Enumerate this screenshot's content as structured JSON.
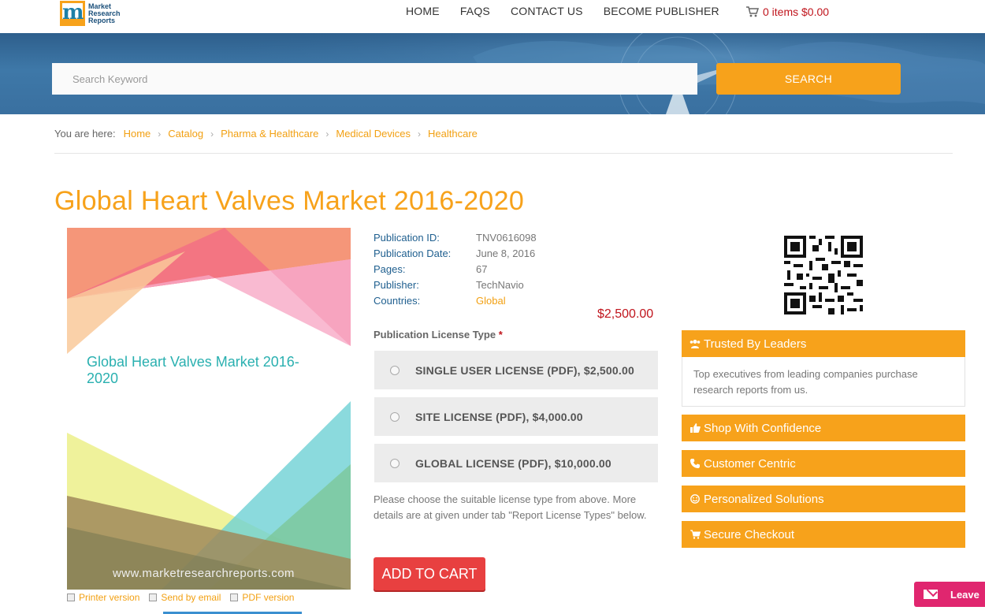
{
  "header": {
    "logo_text": [
      "Market",
      "Research",
      "Reports"
    ],
    "nav": [
      "HOME",
      "FAQS",
      "CONTACT US",
      "BECOME PUBLISHER"
    ],
    "cart": "0 items $0.00"
  },
  "search": {
    "placeholder": "Search Keyword",
    "button": "SEARCH"
  },
  "breadcrumb": {
    "lead": "You are here:",
    "items": [
      "Home",
      "Catalog",
      "Pharma & Healthcare",
      "Medical Devices",
      "Healthcare"
    ]
  },
  "title": "Global Heart Valves Market 2016-2020",
  "cover": {
    "title": "Global Heart Valves Market 2016-2020",
    "url": "www.marketresearchreports.com",
    "links": [
      "Printer version",
      "Send by email",
      "PDF version"
    ]
  },
  "meta": {
    "rows": [
      {
        "label": "Publication ID:",
        "value": "TNV0616098"
      },
      {
        "label": "Publication Date:",
        "value": "June 8, 2016"
      },
      {
        "label": "Pages:",
        "value": "67"
      },
      {
        "label": "Publisher:",
        "value": "TechNavio"
      },
      {
        "label": "Countries:",
        "value": "Global"
      }
    ],
    "price": "$2,500.00"
  },
  "license": {
    "label": "Publication License Type",
    "required": "*",
    "options": [
      "SINGLE USER LICENSE (PDF), $2,500.00",
      "SITE LICENSE (PDF), $4,000.00",
      "GLOBAL LICENSE (PDF), $10,000.00"
    ],
    "note": "Please choose the suitable license type from above. More details are at given under tab \"Report License Types\" below.",
    "add_to_cart": "ADD TO CART"
  },
  "features": {
    "items": [
      {
        "label": "Trusted By Leaders",
        "icon": "users-icon"
      },
      {
        "label": "Shop With Confidence",
        "icon": "thumbs-up-icon"
      },
      {
        "label": "Customer Centric",
        "icon": "phone-icon"
      },
      {
        "label": "Personalized Solutions",
        "icon": "smile-icon"
      },
      {
        "label": "Secure Checkout",
        "icon": "cart-icon"
      }
    ],
    "trusted_desc": "Top executives from leading companies purchase research reports from us."
  },
  "leave": "Leave",
  "colors": {
    "accent": "#f7a21b",
    "price": "#c0141c",
    "add_to_cart": "#e84040",
    "banner": "#3a70a0"
  }
}
